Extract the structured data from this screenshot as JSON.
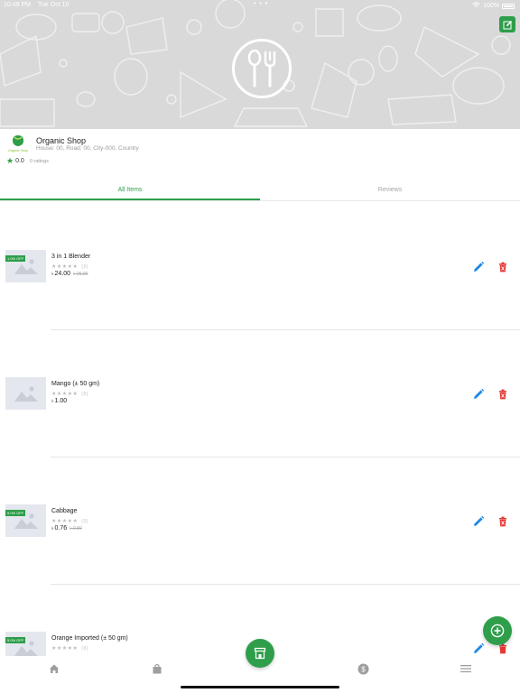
{
  "status_bar": {
    "time": "10:49 PM",
    "date": "Tue Oct 10",
    "battery": "100%"
  },
  "shop": {
    "name": "Organic Shop",
    "logo_text": "Organic Shop",
    "address": "House: 00, Road: 00, City-000, Country",
    "rating": "0.0",
    "rating_count": "0 ratings"
  },
  "tabs": [
    {
      "label": "All Items",
      "active": true
    },
    {
      "label": "Reviews",
      "active": false
    }
  ],
  "items": [
    {
      "name": "3 in 1 Blender",
      "review_count": "(0)",
      "currency": "৳",
      "price": "24.00",
      "old_price": "৳ 25.00",
      "discount": "1.0% OFF"
    },
    {
      "name": "Mango (± 50 gm)",
      "review_count": "(0)",
      "currency": "৳",
      "price": "1.00",
      "old_price": "",
      "discount": ""
    },
    {
      "name": "Cabbage",
      "review_count": "(0)",
      "currency": "৳",
      "price": "0.76",
      "old_price": "৳ 0.80",
      "discount": "5.0% OFF"
    },
    {
      "name": "Orange Imported (± 50 gm)",
      "review_count": "(0)",
      "currency": "",
      "price": "",
      "old_price": "",
      "discount": "5.0% OFF"
    }
  ],
  "stars_glyph": "★★★★★",
  "colors": {
    "accent": "#2e9e4a",
    "edit": "#1e88e5",
    "delete": "#e53935",
    "cover": "#d9d9d9"
  },
  "bottom_nav": [
    "home-icon",
    "bag-icon",
    "store-icon",
    "dollar-icon",
    "menu-icon"
  ]
}
